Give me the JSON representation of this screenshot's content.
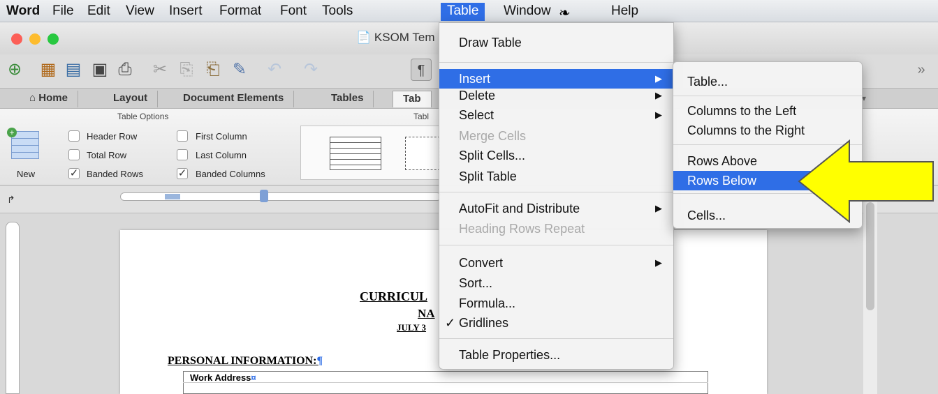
{
  "menubar": {
    "app": "Word",
    "items": [
      "File",
      "Edit",
      "View",
      "Insert",
      "Format",
      "Font",
      "Tools",
      "Table",
      "Window",
      "Help"
    ]
  },
  "title": "KSOM Tem",
  "tabs": [
    "Home",
    "Layout",
    "Document Elements",
    "Tables",
    "Tab"
  ],
  "ribbon": {
    "group_label": "Table Options",
    "group2_label": "Tabl",
    "new_label": "New",
    "header_row": "Header Row",
    "total_row": "Total Row",
    "banded_rows": "Banded Rows",
    "first_column": "First Column",
    "last_column": "Last Column",
    "banded_columns": "Banded Columns",
    "checkmark": "✓"
  },
  "table_menu": {
    "draw_table": "Draw Table",
    "insert": "Insert",
    "delete": "Delete",
    "select": "Select",
    "merge_cells": "Merge Cells",
    "split_cells": "Split Cells...",
    "split_table": "Split Table",
    "autofit": "AutoFit and Distribute",
    "heading_rows": "Heading Rows Repeat",
    "convert": "Convert",
    "sort": "Sort...",
    "formula": "Formula...",
    "gridlines": "Gridlines",
    "gridlines_check": "✓",
    "table_properties": "Table Properties..."
  },
  "insert_submenu": {
    "table": "Table...",
    "cols_left": "Columns to the Left",
    "cols_right": "Columns to the Right",
    "rows_above": "Rows Above",
    "rows_below": "Rows Below",
    "cells": "Cells..."
  },
  "document": {
    "heading1": "CURRICUL",
    "heading2": "NA",
    "heading3": "JULY 3",
    "section": "PERSONAL INFORMATION:",
    "pilcrow": "¶",
    "cell": "Work Address",
    "cell_mark": "¤"
  },
  "colors": {
    "highlight": "#2f6ee6",
    "arrow": "#ffff00"
  }
}
